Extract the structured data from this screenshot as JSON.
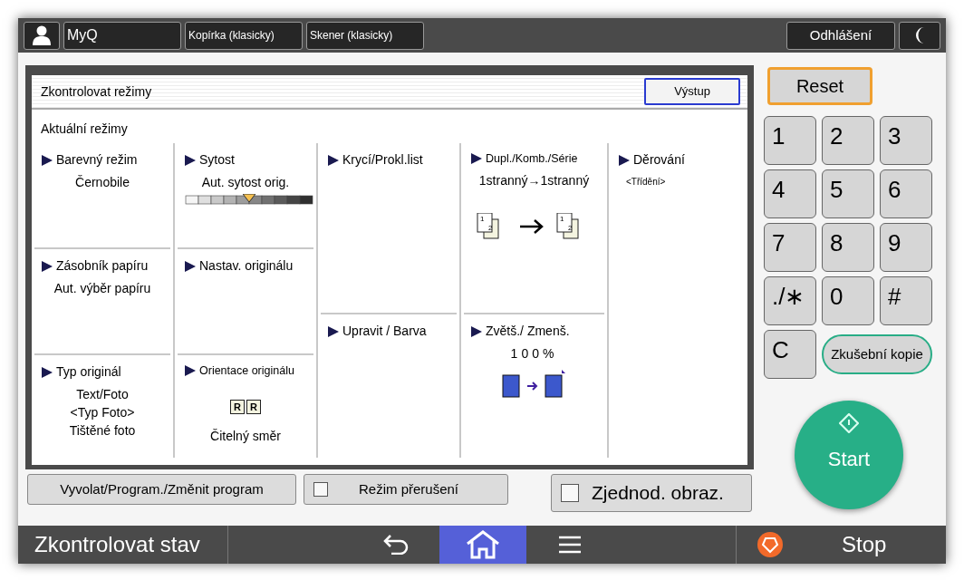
{
  "top_bar": {
    "tabs": [
      {
        "label": "MyQ"
      },
      {
        "label": "Kopírka (klasicky)"
      },
      {
        "label": "Skener (klasicky)"
      }
    ],
    "logout": "Odhlášení"
  },
  "dialog": {
    "title": "Zkontrolovat režimy",
    "exit_button": "Výstup",
    "subtitle": "Aktuální režimy",
    "columns": [
      [
        {
          "kind": "plain",
          "title": "Barevný režim",
          "lines": [
            "Černobile"
          ]
        },
        {
          "kind": "plain",
          "title": "Zásobník papíru",
          "lines": [
            "Aut. výběr papíru"
          ]
        },
        {
          "kind": "plain",
          "title": "Typ originál",
          "lines": [
            "Text/Foto",
            "<Typ Foto>",
            "Tištěné foto"
          ]
        }
      ],
      [
        {
          "kind": "density",
          "title": "Sytost",
          "lines": [
            "Aut. sytost orig."
          ],
          "level": 0.5
        },
        {
          "kind": "plain",
          "title": "Nastav. originálu"
        },
        {
          "kind": "orientation",
          "title": "Orientace originálu",
          "letters": [
            "R",
            "R"
          ],
          "lines": [
            "Čitelný směr"
          ]
        }
      ],
      [
        {
          "kind": "plain",
          "title": "Krycí/Prokl.list"
        },
        {
          "kind": "plain",
          "title": "Upravit / Barva"
        }
      ],
      [
        {
          "kind": "duplex",
          "title": "Dupl./Komb./Série",
          "lines": [
            "1stranný→1stranný"
          ],
          "page_numbers": [
            "1",
            "2",
            "1",
            "2"
          ]
        },
        {
          "kind": "zoom",
          "title": "Zvětš./ Zmenš.",
          "lines": [
            "100%"
          ]
        }
      ],
      [
        {
          "kind": "note",
          "title": "Děrování",
          "lines": [
            "<Třídění>"
          ]
        }
      ]
    ]
  },
  "program_button": "Vyvolat/Program./Změnit program",
  "interrupt": {
    "label": "Režim přerušení",
    "checked": false
  },
  "simplified": {
    "label": "Zjednod. obraz.",
    "checked": false
  },
  "reset": "Reset",
  "keys": [
    "1",
    "2",
    "3",
    "4",
    "5",
    "6",
    "7",
    "8",
    "9",
    "./∗",
    "0",
    "#",
    "C"
  ],
  "test_copy": "Zkušební kopie",
  "start": "Start",
  "bottom_bar": {
    "status": "Zkontrolovat stav",
    "nav": [
      {
        "kind": "back",
        "selected": false
      },
      {
        "kind": "home",
        "selected": true
      },
      {
        "kind": "menu",
        "selected": false
      }
    ],
    "stop": "Stop"
  }
}
